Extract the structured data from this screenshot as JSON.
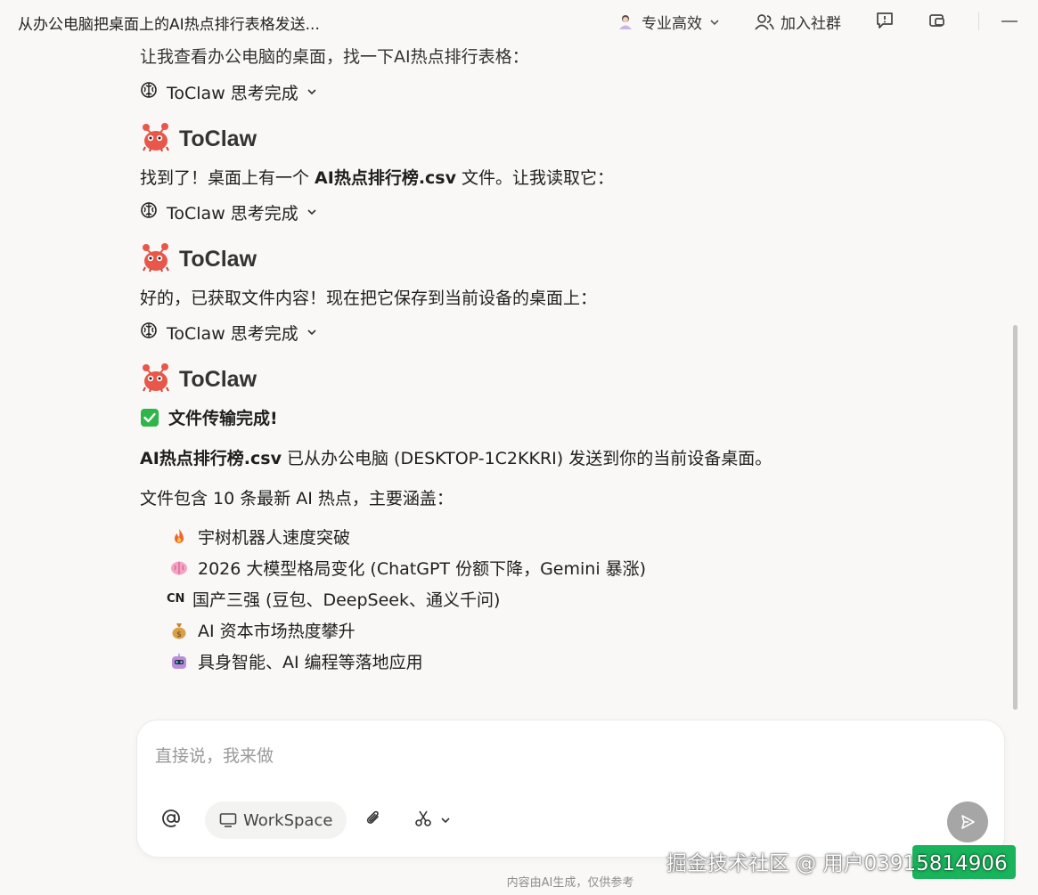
{
  "window": {
    "title": "从办公电脑把桌面上的AI热点排行表格发送...",
    "mode_label": "专业高效",
    "join_label": "加入社群"
  },
  "messages": {
    "partial_top": "让我查看办公电脑的桌面，找一下AI热点排行表格：",
    "think_label": "ToClaw 思考完成",
    "agent_name": "ToClaw",
    "msg1": {
      "pre": "找到了！桌面上有一个 ",
      "bold": "AI热点排行榜.csv",
      "post": " 文件。让我读取它："
    },
    "msg2": "好的，已获取文件内容！现在把它保存到当前设备的桌面上：",
    "msg3": {
      "done_title": "文件传输完成!",
      "sent_bold": "AI热点排行榜.csv",
      "sent_rest": " 已从办公电脑 (DESKTOP-1C2KKRI) 发送到你的当前设备桌面。",
      "summary": "文件包含 10 条最新 AI 热点，主要涵盖：",
      "cn_flag": "CN",
      "bullets": [
        "宇树机器人速度突破",
        "2026 大模型格局变化 (ChatGPT 份额下降，Gemini 暴涨)",
        "国产三强 (豆包、DeepSeek、通义千问)",
        "AI 资本市场热度攀升",
        "具身智能、AI 编程等落地应用"
      ]
    }
  },
  "composer": {
    "placeholder": "直接说，我来做",
    "workspace_label": "WorkSpace"
  },
  "footer": {
    "note": "内容由AI生成，仅供参考",
    "watermark": "掘金技术社区 @ 用户0391581​4906"
  },
  "colors": {
    "send_button": "#a6a6a6",
    "check": "#2fb54a",
    "badge": "#18b35a"
  },
  "icons": [
    "brain-icon",
    "chevron-down-icon",
    "crab-avatar-icon",
    "check-icon",
    "fire-icon",
    "brain-emoji-icon",
    "money-bag-icon",
    "robot-icon",
    "at-icon",
    "monitor-icon",
    "paperclip-icon",
    "scissors-icon",
    "send-icon",
    "user-group-icon",
    "feedback-icon",
    "window-icon",
    "minimize-icon"
  ]
}
